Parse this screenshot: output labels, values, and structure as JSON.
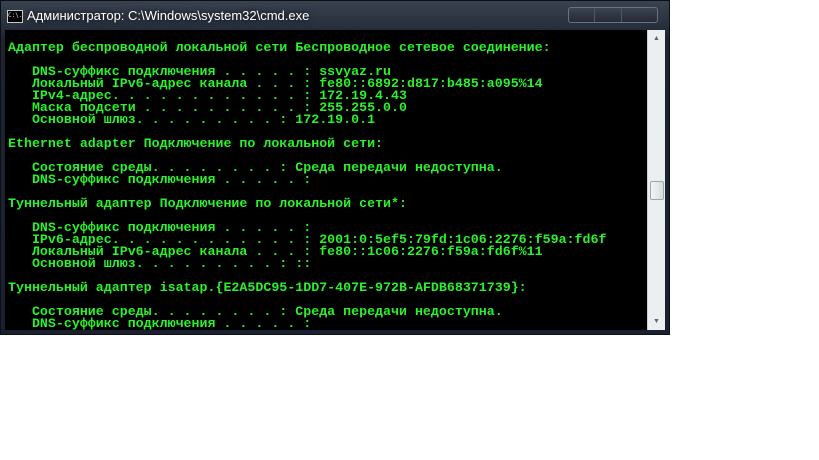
{
  "window": {
    "title": "Администратор: C:\\Windows\\system32\\cmd.exe",
    "icon_text": "C:\\."
  },
  "console": {
    "lines": [
      "Адаптер беспроводной локальной сети Беспроводное сетевое соединение:",
      "",
      "   DNS-суффикс подключения . . . . . : ssvyaz.ru",
      "   Локальный IPv6-адрес канала . . . : fe80::6892:d817:b485:a095%14",
      "   IPv4-адрес. . . . . . . . . . . . : 172.19.4.43",
      "   Маска подсети . . . . . . . . . . : 255.255.0.0",
      "   Основной шлюз. . . . . . . . . : 172.19.0.1",
      "",
      "Ethernet adapter Подключение по локальной сети:",
      "",
      "   Состояние среды. . . . . . . . : Среда передачи недоступна.",
      "   DNS-суффикс подключения . . . . . :",
      "",
      "Туннельный адаптер Подключение по локальной сети*:",
      "",
      "   DNS-суффикс подключения . . . . . :",
      "   IPv6-адрес. . . . . . . . . . . . : 2001:0:5ef5:79fd:1c06:2276:f59a:fd6f",
      "   Локальный IPv6-адрес канала . . . : fe80::1c06:2276:f59a:fd6f%11",
      "   Основной шлюз. . . . . . . . . : ::",
      "",
      "Туннельный адаптер isatap.{E2A5DC95-1DD7-407E-972B-AFDB68371739}:",
      "",
      "   Состояние среды. . . . . . . . : Среда передачи недоступна.",
      "   DNS-суффикс подключения . . . . . :"
    ]
  },
  "colors": {
    "console_text": "#2bf02b",
    "console_bg": "#000000"
  },
  "scrollbar": {
    "up_icon": "▲",
    "down_icon": "▼",
    "position_fraction": 0.5
  }
}
